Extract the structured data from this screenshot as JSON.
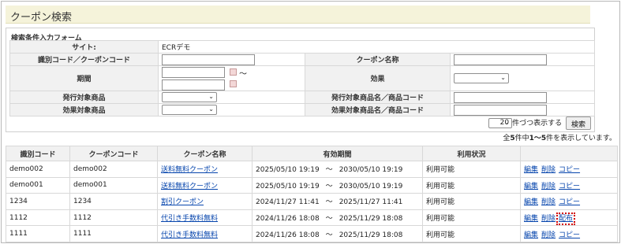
{
  "page": {
    "title": "クーポン検索"
  },
  "form": {
    "title": "検索条件入力フォーム",
    "site_label": "サイト:",
    "site_value": "ECRデモ",
    "code_label": "識別コード／クーポンコード",
    "name_label": "クーポン名称",
    "period_label": "期間",
    "period_sep": "〜",
    "effect_label": "効果",
    "issue_item_label": "発行対象商品",
    "issue_item_name_label": "発行対象商品名／商品コード",
    "effect_item_label": "効果対象商品",
    "effect_item_name_label": "効果対象商品名／商品コード",
    "per_page_value": "20",
    "per_page_suffix": "件づつ表示する",
    "search_button": "検索"
  },
  "summary": {
    "prefix": "全",
    "total": "5",
    "mid": "件中",
    "range": "1〜5",
    "suffix": "件を表示しています。"
  },
  "table": {
    "headers": [
      "識別コード",
      "クーポンコード",
      "クーポン名称",
      "有効期間",
      "利用状況",
      ""
    ],
    "period_sep": "〜",
    "actions": {
      "edit": "編集",
      "delete": "削除",
      "copy": "コピー",
      "distribute": "配布"
    },
    "rows": [
      {
        "id": "demo002",
        "code": "demo002",
        "name": "送料無料クーポン",
        "start": "2025/05/10 19:19",
        "end": "2030/05/10 19:19",
        "status": "利用可能",
        "third_action": "copy"
      },
      {
        "id": "demo001",
        "code": "demo001",
        "name": "送料無料クーポン",
        "start": "2025/05/10 19:19",
        "end": "2030/05/10 19:19",
        "status": "利用可能",
        "third_action": "copy"
      },
      {
        "id": "1234",
        "code": "1234",
        "name": "割引クーポン",
        "start": "2024/11/27 11:41",
        "end": "2025/11/27 11:41",
        "status": "利用可能",
        "third_action": "copy"
      },
      {
        "id": "1112",
        "code": "1112",
        "name": "代引き手数料無料",
        "start": "2024/11/26 18:08",
        "end": "2025/11/29 18:08",
        "status": "利用可能",
        "third_action": "distribute"
      },
      {
        "id": "1111",
        "code": "1111",
        "name": "代引き手数料無料",
        "start": "2024/11/26 18:08",
        "end": "2025/11/29 18:08",
        "status": "利用可能",
        "third_action": "copy"
      }
    ]
  },
  "colors": {
    "title_bg": "#f5f3da",
    "header_bg": "#f1f1f1",
    "link": "#0645ad",
    "highlight": "#d00000"
  }
}
